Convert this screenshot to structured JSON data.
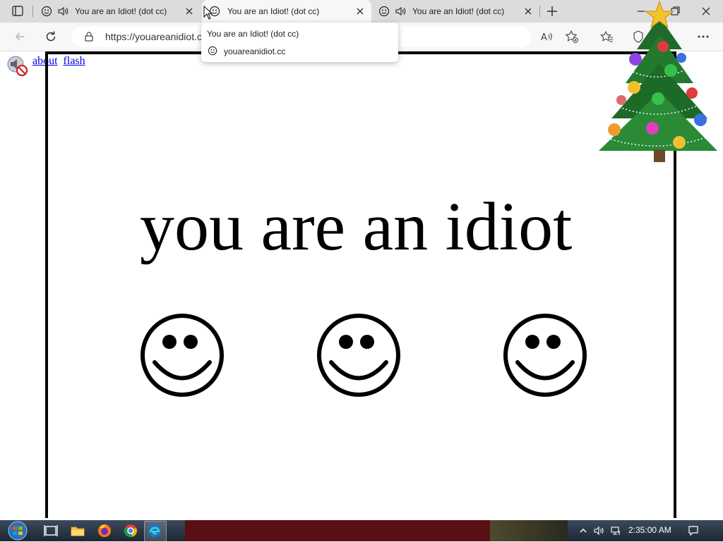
{
  "browser": {
    "tabs": [
      {
        "title": "You are an Idiot! (dot cc)",
        "active": false,
        "audio": true
      },
      {
        "title": "You are an Idiot! (dot cc)",
        "active": true,
        "audio": false
      },
      {
        "title": "You are an Idiot! (dot cc)",
        "active": false,
        "audio": true
      }
    ],
    "address": "https://youareanidiot.c",
    "hover_card": {
      "title": "You are an Idiot! (dot cc)",
      "domain": "youareanidiot.cc"
    }
  },
  "page": {
    "links": {
      "about": "about",
      "flash": "flash"
    },
    "headline": "you are an idiot",
    "smiley_count": 3
  },
  "taskbar": {
    "apps": [
      "task-view",
      "file-explorer",
      "firefox",
      "chrome",
      "edge"
    ],
    "clock": "2:35:00 AM"
  },
  "colors": {
    "link": "#0000ee",
    "frame": "#000000",
    "taskbar_accent": "#5a0f14"
  }
}
